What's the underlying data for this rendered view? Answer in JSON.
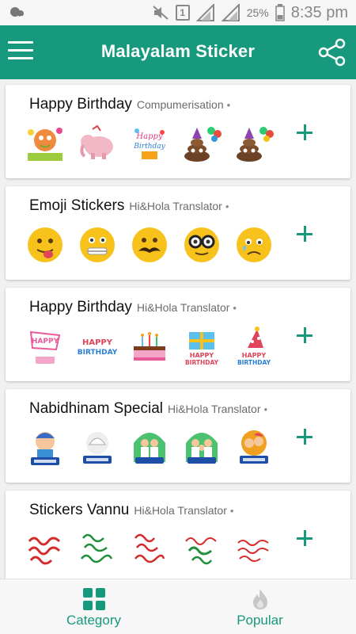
{
  "status": {
    "battery": "25%",
    "time": "8:35 pm",
    "sim": "1"
  },
  "appbar": {
    "title": "Malayalam Sticker"
  },
  "packs": [
    {
      "title": "Happy Birthday",
      "author": "Compumerisation",
      "dot": "•",
      "stickers": [
        "cartoon-cat-icon",
        "elephant-icon",
        "happy-birthday-text-icon",
        "poop-balloons-icon",
        "poop-balloons-icon"
      ]
    },
    {
      "title": "Emoji Stickers",
      "author": "Hi&Hola Translator",
      "dot": "•",
      "stickers": [
        "tongue-emoji-icon",
        "braces-emoji-icon",
        "mustache-emoji-icon",
        "glasses-emoji-icon",
        "sad-emoji-icon"
      ]
    },
    {
      "title": "Happy Birthday",
      "author": "Hi&Hola Translator",
      "dot": "•",
      "stickers": [
        "happy-birthday-cake-icon",
        "happy-birthday-text-icon",
        "birthday-cake-icon",
        "gift-box-icon",
        "party-hat-icon"
      ]
    },
    {
      "title": "Nabidhinam Special",
      "author": "Hi&Hola Translator",
      "dot": "•",
      "stickers": [
        "kid-greeting-icon",
        "mosque-greeting-icon",
        "family-greeting-icon",
        "family-greeting-icon",
        "kids-greeting-icon"
      ]
    },
    {
      "title": "Stickers Vannu",
      "author": "Hi&Hola Translator",
      "dot": "•",
      "stickers": [
        "malayalam-text-red-icon",
        "malayalam-text-green-icon",
        "malayalam-text-red-icon",
        "malayalam-text-green-icon",
        "malayalam-text-red-icon"
      ]
    }
  ],
  "nav": {
    "category": "Category",
    "popular": "Popular"
  },
  "colors": {
    "primary": "#17997d",
    "background": "#f1f1f1"
  }
}
